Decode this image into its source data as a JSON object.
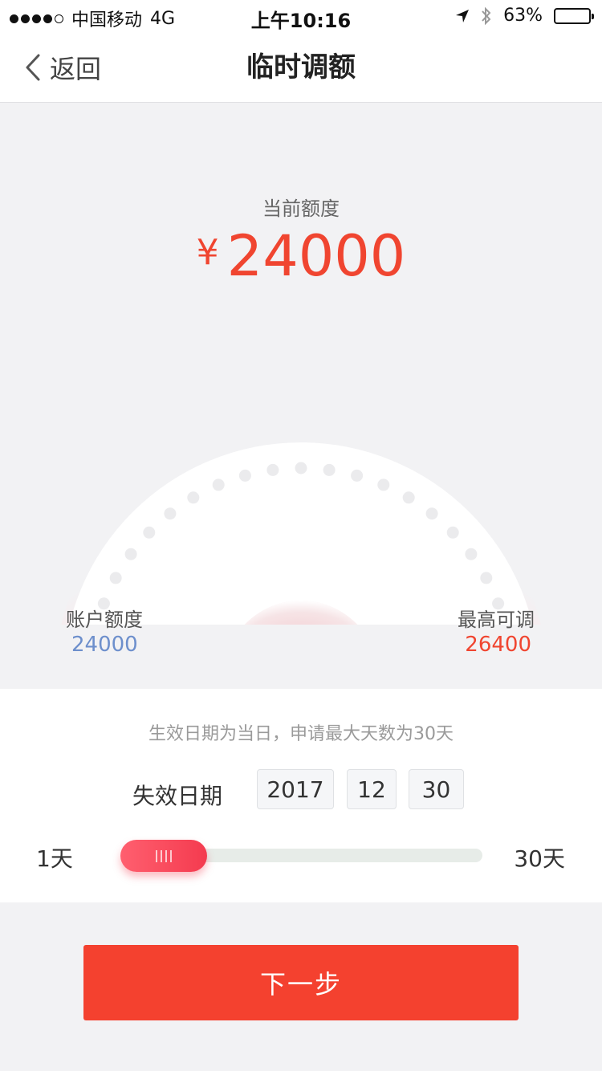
{
  "status_bar": {
    "carrier": "中国移动",
    "network": "4G",
    "time": "上午10:16",
    "battery_percent": "63%",
    "battery_level": 0.63,
    "icons": [
      "location-arrow-icon",
      "bluetooth-icon",
      "battery-icon"
    ]
  },
  "nav": {
    "back_label": "返回",
    "title": "临时调额"
  },
  "hero": {
    "current_label": "当前额度",
    "currency_symbol": "¥",
    "current_amount": "24000",
    "account_limit_label": "账户额度",
    "account_limit_value": "24000",
    "max_limit_label": "最高可调",
    "max_limit_value": "26400",
    "gauge_level": 0
  },
  "panel": {
    "note": "生效日期为当日，申请最大天数为30天",
    "expiry_label": "失效日期",
    "expiry_year": "2017",
    "expiry_month": "12",
    "expiry_day": "30",
    "slider_min_label": "1天",
    "slider_max_label": "30天",
    "slider_value_days": 1
  },
  "next_button_label": "下一步",
  "colors": {
    "accent": "#f4412f",
    "account_value": "#6d8fcc",
    "background": "#f2f2f4"
  }
}
